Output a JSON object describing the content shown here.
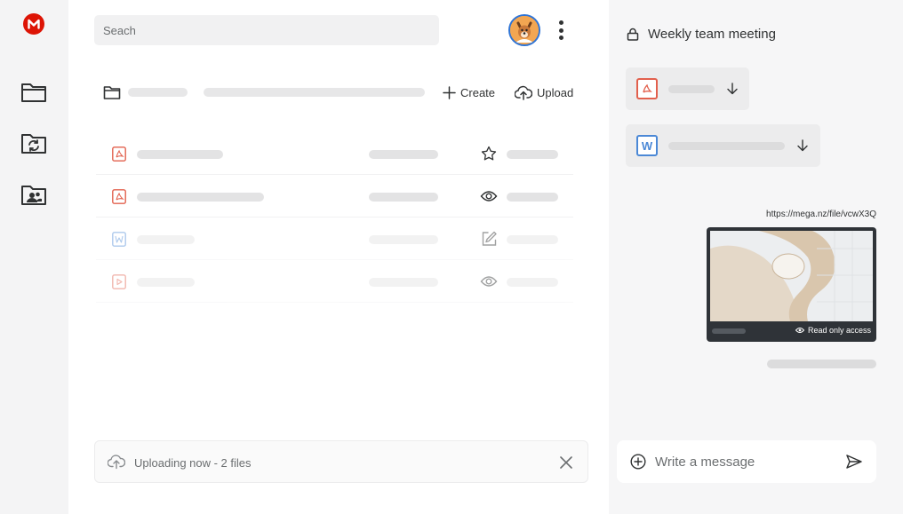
{
  "rail": {
    "logo_letter": "M",
    "items": [
      {
        "name": "cloud-drive",
        "icon": "folder-icon"
      },
      {
        "name": "sync",
        "icon": "folder-sync-icon"
      },
      {
        "name": "shared",
        "icon": "folder-users-icon"
      }
    ]
  },
  "header": {
    "search_placeholder": "Seach",
    "menu_icon": "more-vertical-icon"
  },
  "toolbar": {
    "create_label": "Create",
    "upload_label": "Upload"
  },
  "files": [
    {
      "type": "pdf",
      "action_icon": "star-icon",
      "faded": false
    },
    {
      "type": "pdf",
      "action_icon": "eye-icon",
      "faded": false
    },
    {
      "type": "word",
      "action_icon": "edit-icon",
      "faded": true
    },
    {
      "type": "video",
      "action_icon": "eye-icon",
      "faded": true
    }
  ],
  "upload_status": {
    "text": "Uploading now - 2 files"
  },
  "chat": {
    "title": "Weekly team meeting",
    "attachments": [
      {
        "type": "pdf",
        "icon_letter": ""
      },
      {
        "type": "word",
        "icon_letter": "W"
      }
    ],
    "link": "https://mega.nz/file/vcwX3Q",
    "link_badge": "Read only access",
    "composer_placeholder": "Write a message"
  },
  "colors": {
    "brand": "#dd1405",
    "pdf": "#e2604d",
    "word": "#4b88d6",
    "text": "#303233"
  }
}
